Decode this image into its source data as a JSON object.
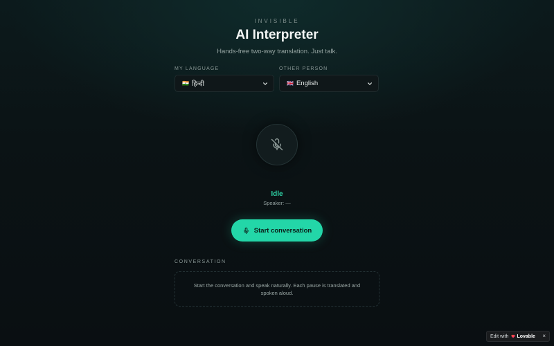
{
  "app": {
    "brand": "INVISIBLE",
    "title": "AI Interpreter",
    "subtitle": "Hands-free two-way translation. Just talk."
  },
  "languages": {
    "mine": {
      "label": "MY LANGUAGE",
      "flag": "🇮🇳",
      "value": "हिन्दी"
    },
    "other": {
      "label": "OTHER PERSON",
      "flag": "🇬🇧",
      "value": "English"
    }
  },
  "status": {
    "state": "Idle",
    "speaker": "Speaker: —"
  },
  "actions": {
    "start_label": "Start conversation"
  },
  "conversation": {
    "label": "CONVERSATION",
    "empty_text": "Start the conversation and speak naturally. Each pause is translated and spoken aloud."
  },
  "badge": {
    "prefix": "Edit with",
    "brand": "Lovable",
    "close": "×"
  },
  "icons": {
    "mic_toggle": "mic-off-icon",
    "start": "mic-icon",
    "select": "chevron-down-icon"
  },
  "colors": {
    "accent": "#23d6a8",
    "status_idle": "#2fd3a6",
    "background": "#0b1315"
  }
}
